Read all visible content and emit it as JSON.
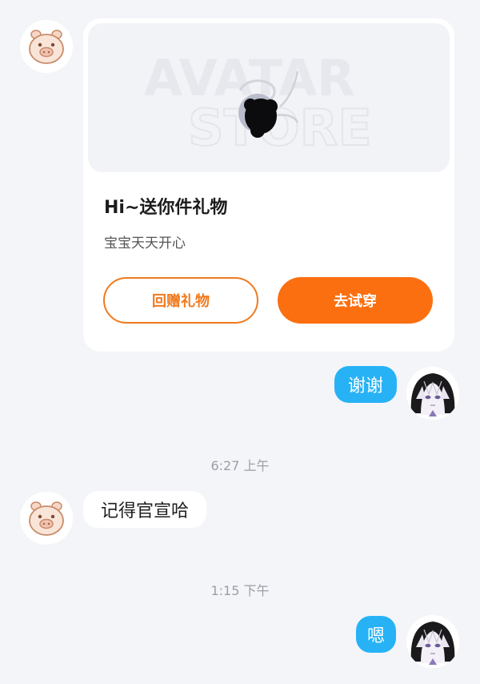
{
  "messages": {
    "gift_card": {
      "banner_watermark_top": "AVATAR",
      "banner_watermark_bottom": "STORE",
      "title": "Hi~送你件礼物",
      "subtitle": "宝宝天天开心",
      "return_gift_label": "回赠礼物",
      "try_on_label": "去试穿"
    },
    "reply_1": "谢谢",
    "time_1": "6:27 上午",
    "peer_message_2": "记得官宣哈",
    "time_2": "1:15 下午",
    "reply_2": "嗯"
  },
  "colors": {
    "accent_orange": "#fb6f10",
    "my_bubble": "#27b2f6",
    "background": "#f4f5f9"
  }
}
